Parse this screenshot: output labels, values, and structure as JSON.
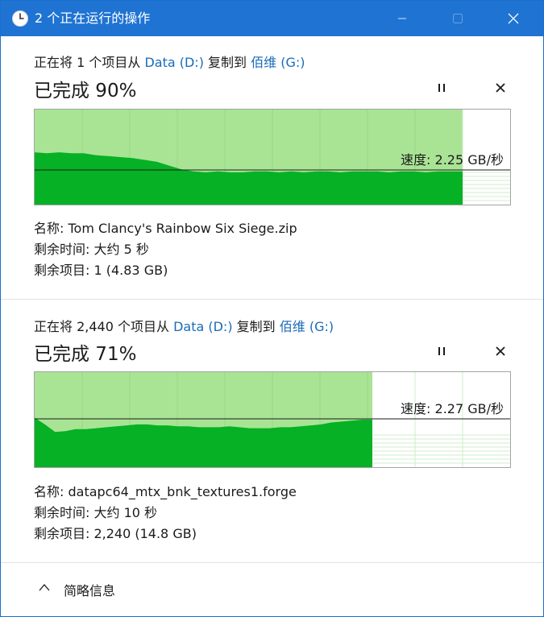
{
  "window": {
    "title": "2 个正在运行的操作",
    "icon": "clock-icon"
  },
  "operations": [
    {
      "prefix": "正在将 1 个项目从 ",
      "source": "Data (D:)",
      "middle": " 复制到 ",
      "destination": "佰维 (G:)",
      "percent_text": "已完成 90%",
      "progress": 0.9,
      "speed_label": "速度: 2.25 GB/秒",
      "name_line": "名称:  Tom Clancy's Rainbow Six Siege.zip",
      "time_line": "剩余时间:  大约 5 秒",
      "items_line": "剩余项目:  1 (4.83 GB)",
      "speed_history": [
        0.55,
        0.54,
        0.55,
        0.54,
        0.54,
        0.52,
        0.51,
        0.5,
        0.49,
        0.47,
        0.45,
        0.41,
        0.37,
        0.35,
        0.34,
        0.35,
        0.34,
        0.34,
        0.35,
        0.35,
        0.34,
        0.35,
        0.34,
        0.35,
        0.35,
        0.34,
        0.35,
        0.35,
        0.35,
        0.34,
        0.35,
        0.35,
        0.34,
        0.35,
        0.35,
        0.35
      ]
    },
    {
      "prefix": "正在将 2,440 个项目从 ",
      "source": "Data (D:)",
      "middle": " 复制到 ",
      "destination": "佰维 (G:)",
      "percent_text": "已完成 71%",
      "progress": 0.71,
      "speed_label": "速度: 2.27 GB/秒",
      "name_line": "名称:  datapc64_mtx_bnk_textures1.forge",
      "time_line": "剩余时间:  大约 10 秒",
      "items_line": "剩余项目:  2,240 (14.8 GB)",
      "speed_history": [
        0.52,
        0.45,
        0.37,
        0.38,
        0.4,
        0.4,
        0.41,
        0.42,
        0.43,
        0.44,
        0.45,
        0.45,
        0.44,
        0.44,
        0.43,
        0.43,
        0.42,
        0.42,
        0.42,
        0.43,
        0.42,
        0.41,
        0.41,
        0.41,
        0.42,
        0.42,
        0.43,
        0.44,
        0.45,
        0.47,
        0.48,
        0.49,
        0.5,
        0.5
      ]
    }
  ],
  "footer": {
    "label": "简略信息"
  },
  "colors": {
    "titlebar": "#1f73d2",
    "fill_light": "#a9e495",
    "fill_dark": "#06b125",
    "link": "#1a6bb8"
  }
}
